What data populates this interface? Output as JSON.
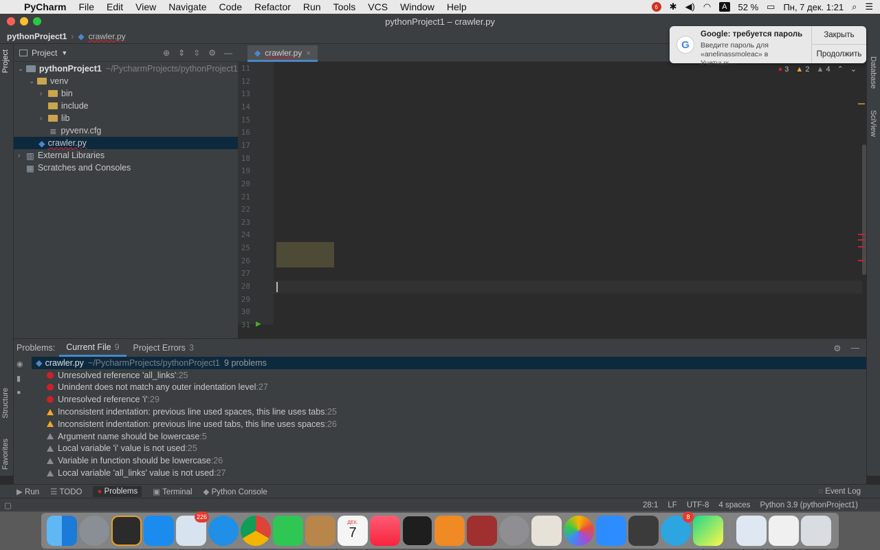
{
  "menubar": {
    "app": "PyCharm",
    "items": [
      "File",
      "Edit",
      "View",
      "Navigate",
      "Code",
      "Refactor",
      "Run",
      "Tools",
      "VCS",
      "Window",
      "Help"
    ],
    "record_badge": "6",
    "input_source": "A",
    "battery": "52 %",
    "clock": "Пн, 7 дек.  1:21"
  },
  "window": {
    "title": "pythonProject1 – crawler.py"
  },
  "navbar": {
    "project": "pythonProject1",
    "file": "crawler.py"
  },
  "project_panel": {
    "title": "Project",
    "tree": [
      {
        "label": "pythonProject1",
        "path": "~/PycharmProjects/pythonProject1"
      },
      {
        "label": "venv"
      },
      {
        "label": "bin"
      },
      {
        "label": "include"
      },
      {
        "label": "lib"
      },
      {
        "label": "pyvenv.cfg"
      },
      {
        "label": "crawler.py"
      },
      {
        "label": "External Libraries"
      },
      {
        "label": "Scratches and Consoles"
      }
    ]
  },
  "editor": {
    "tab": "crawler.py",
    "inspections": {
      "errors": "3",
      "warnings": "2",
      "weak": "4"
    },
    "line_numbers": [
      "11",
      "12",
      "13",
      "14",
      "15",
      "16",
      "17",
      "18",
      "19",
      "20",
      "21",
      "22",
      "23",
      "24",
      "25",
      "26",
      "27",
      "28",
      "29",
      "30",
      "31"
    ]
  },
  "notification": {
    "title": "Google: требуется пароль",
    "message": "Введите пароль для «anelinassmoleac» в Учетных…",
    "close_label": "Закрыть",
    "continue_label": "Продолжить"
  },
  "problems": {
    "label": "Problems:",
    "tabs": [
      {
        "label": "Current File",
        "count": "9"
      },
      {
        "label": "Project Errors",
        "count": "3"
      }
    ],
    "file": {
      "name": "crawler.py",
      "path": "~/PycharmProjects/pythonProject1",
      "count": "9 problems"
    },
    "items": [
      {
        "severity": "error",
        "text": "Unresolved reference 'all_links'",
        "line": ":25"
      },
      {
        "severity": "error",
        "text": "Unindent does not match any outer indentation level",
        "line": ":27"
      },
      {
        "severity": "error",
        "text": "Unresolved reference 'i'",
        "line": ":29"
      },
      {
        "severity": "warning",
        "text": "Inconsistent indentation: previous line used spaces, this line uses tabs",
        "line": ":25"
      },
      {
        "severity": "warning",
        "text": "Inconsistent indentation: previous line used tabs, this line uses spaces",
        "line": ":26"
      },
      {
        "severity": "weak",
        "text": "Argument name should be lowercase",
        "line": ":5"
      },
      {
        "severity": "weak",
        "text": "Local variable 'i' value is not used",
        "line": ":25"
      },
      {
        "severity": "weak",
        "text": "Variable in function should be lowercase",
        "line": ":26"
      },
      {
        "severity": "weak",
        "text": "Local variable 'all_links' value is not used",
        "line": ":27"
      }
    ]
  },
  "bottom_tools": [
    "Run",
    "TODO",
    "Problems",
    "Terminal",
    "Python Console",
    "Event Log"
  ],
  "statusbar": {
    "position": "28:1",
    "line_sep": "LF",
    "encoding": "UTF-8",
    "indent": "4 spaces",
    "interpreter": "Python 3.9 (pythonProject1)"
  },
  "side_labels": {
    "left_top": "Project",
    "left_mid": "Structure",
    "left_bottom": "Favorites",
    "right_top": "Database",
    "right_mid": "SciView"
  },
  "dock": {
    "badges": {
      "mail": "226",
      "telegram": "8"
    },
    "calendar_month": "ДЕК.",
    "calendar_day": "7"
  }
}
